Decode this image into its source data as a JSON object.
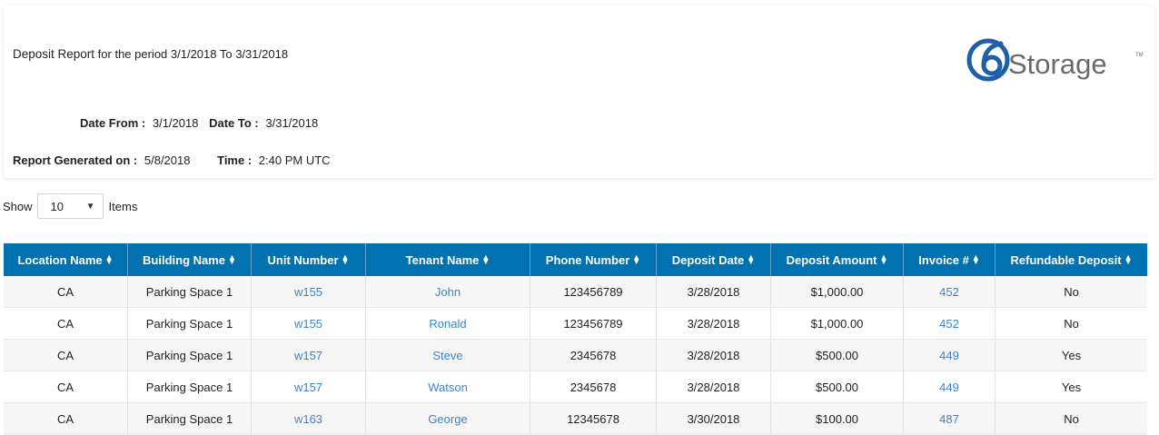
{
  "report": {
    "title": "Deposit Report",
    "period_text": "for the period 3/1/2018 To 3/31/2018",
    "date_from_label": "Date From :",
    "date_from": "3/1/2018",
    "date_to_label": "Date To :",
    "date_to": "3/31/2018",
    "generated_label": "Report Generated on :",
    "generated_on": "5/8/2018",
    "time_label": "Time :",
    "time": "2:40 PM UTC"
  },
  "logo": {
    "digit": "6",
    "text": "Storage",
    "tm": "TM",
    "color": "#1f5fa8",
    "text_color": "#6a6a6a"
  },
  "pager": {
    "show_label": "Show",
    "page_size": "10",
    "items_label": "Items"
  },
  "colors": {
    "header_bg": "#0072b1",
    "link": "#3a85cf",
    "row_alt": "#f6f6f6"
  },
  "table": {
    "columns": [
      "Location Name",
      "Building Name",
      "Unit Number",
      "Tenant Name",
      "Phone Number",
      "Deposit Date",
      "Deposit Amount",
      "Invoice #",
      "Refundable Deposit"
    ],
    "rows": [
      [
        "CA",
        "Parking Space 1",
        "w155",
        "John",
        "123456789",
        "3/28/2018",
        "$1,000.00",
        "452",
        "No"
      ],
      [
        "CA",
        "Parking Space 1",
        "w155",
        "Ronald",
        "123456789",
        "3/28/2018",
        "$1,000.00",
        "452",
        "No"
      ],
      [
        "CA",
        "Parking Space 1",
        "w157",
        "Steve",
        "2345678",
        "3/28/2018",
        "$500.00",
        "449",
        "Yes"
      ],
      [
        "CA",
        "Parking Space 1",
        "w157",
        "Watson",
        "2345678",
        "3/28/2018",
        "$500.00",
        "449",
        "Yes"
      ],
      [
        "CA",
        "Parking Space 1",
        "w163",
        "George",
        "12345678",
        "3/30/2018",
        "$100.00",
        "487",
        "No"
      ]
    ]
  }
}
